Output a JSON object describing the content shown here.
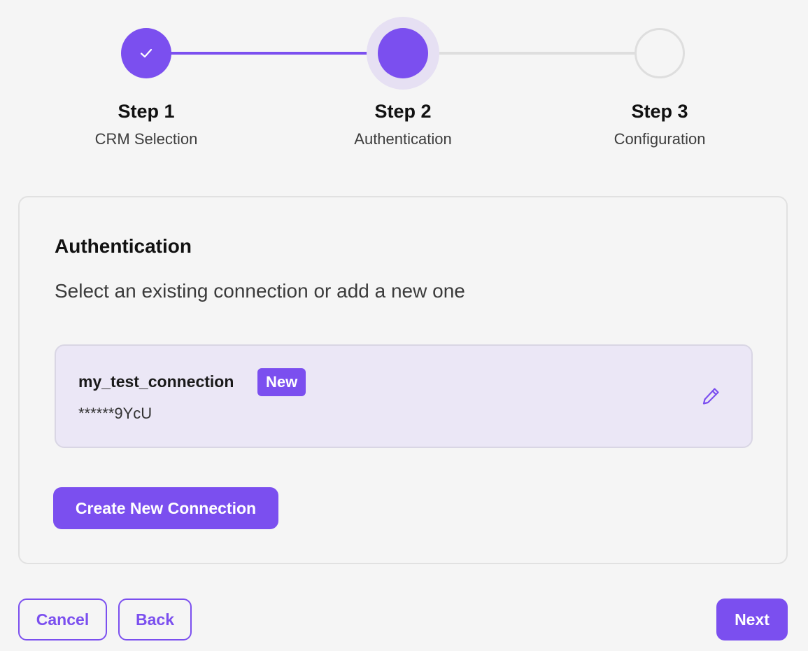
{
  "stepper": {
    "steps": [
      {
        "label": "Step 1",
        "sublabel": "CRM Selection",
        "state": "completed",
        "icon": "check-icon"
      },
      {
        "label": "Step 2",
        "sublabel": "Authentication",
        "state": "active"
      },
      {
        "label": "Step 3",
        "sublabel": "Configuration",
        "state": "pending"
      }
    ]
  },
  "card": {
    "title": "Authentication",
    "description": "Select an existing connection or add a new one",
    "connections": [
      {
        "name": "my_test_connection",
        "badge": "New",
        "masked_key": "******9YcU",
        "action_icon": "pencil-icon"
      }
    ],
    "create_button_label": "Create New Connection"
  },
  "footer": {
    "cancel_label": "Cancel",
    "back_label": "Back",
    "next_label": "Next"
  },
  "colors": {
    "accent": "#7b4fef",
    "accent_soft": "#e6e0f3",
    "selected_bg": "#ebe7f6",
    "pending_line": "#dedede",
    "background": "#f5f5f5"
  }
}
